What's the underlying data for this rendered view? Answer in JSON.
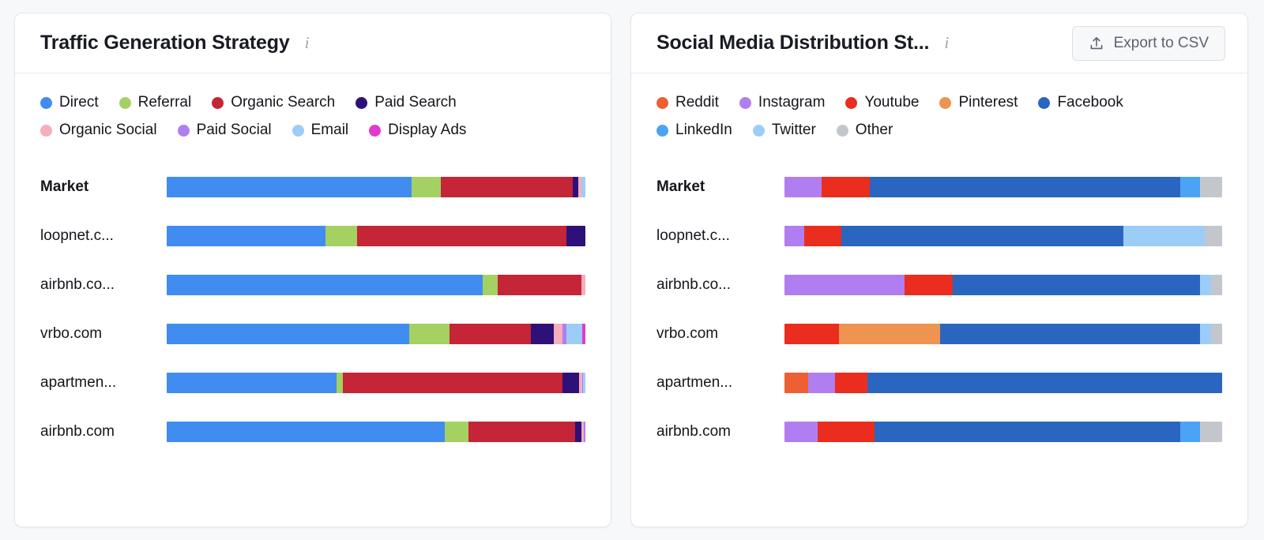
{
  "panels": [
    {
      "title": "Traffic Generation Strategy",
      "info_icon": "info-icon",
      "has_export": false,
      "export_label": "",
      "legend": [
        {
          "label": "Direct",
          "color": "#418cf0"
        },
        {
          "label": "Referral",
          "color": "#a4d162"
        },
        {
          "label": "Organic Search",
          "color": "#c42537"
        },
        {
          "label": "Paid Search",
          "color": "#2e1178"
        },
        {
          "label": "Organic Social",
          "color": "#f4aebc"
        },
        {
          "label": "Paid Social",
          "color": "#b07ef0"
        },
        {
          "label": "Email",
          "color": "#9ccdf7"
        },
        {
          "label": "Display Ads",
          "color": "#e03ad0"
        }
      ],
      "rows": [
        {
          "label": "Market",
          "bold": true
        },
        {
          "label": "loopnet.c...",
          "bold": false
        },
        {
          "label": "airbnb.co...",
          "bold": false
        },
        {
          "label": "vrbo.com",
          "bold": false
        },
        {
          "label": "apartmen...",
          "bold": false
        },
        {
          "label": "airbnb.com",
          "bold": false
        }
      ],
      "chart_data": {
        "type": "bar",
        "title": "Traffic Generation Strategy",
        "orientation": "horizontal",
        "stacked": true,
        "normalized": true,
        "xlabel": "",
        "ylabel": "Market",
        "xlim": [
          0,
          100
        ],
        "grid": false,
        "legend_position": "top",
        "categories": [
          "Market",
          "loopnet.c...",
          "airbnb.co...",
          "vrbo.com",
          "apartmen...",
          "airbnb.com"
        ],
        "series": [
          {
            "name": "Direct",
            "color": "#418cf0",
            "values": [
              58.5,
              38.0,
              75.5,
              58.0,
              40.5,
              66.5
            ]
          },
          {
            "name": "Referral",
            "color": "#a4d162",
            "values": [
              7.0,
              7.5,
              3.5,
              9.5,
              1.5,
              5.5
            ]
          },
          {
            "name": "Organic Search",
            "color": "#c42537",
            "values": [
              31.5,
              50.0,
              20.0,
              19.5,
              52.5,
              25.5
            ]
          },
          {
            "name": "Paid Search",
            "color": "#2e1178",
            "values": [
              1.3,
              4.5,
              0.0,
              5.5,
              4.0,
              1.5
            ]
          },
          {
            "name": "Organic Social",
            "color": "#f4aebc",
            "values": [
              0.8,
              0.0,
              1.0,
              2.0,
              0.7,
              0.7
            ]
          },
          {
            "name": "Paid Social",
            "color": "#b07ef0",
            "values": [
              0.0,
              0.0,
              0.0,
              1.0,
              0.3,
              0.3
            ]
          },
          {
            "name": "Email",
            "color": "#9ccdf7",
            "values": [
              0.9,
              0.0,
              0.0,
              3.8,
              0.5,
              0.0
            ]
          },
          {
            "name": "Display Ads",
            "color": "#e03ad0",
            "values": [
              0.0,
              0.0,
              0.0,
              0.7,
              0.0,
              0.0
            ]
          }
        ]
      }
    },
    {
      "title": "Social Media Distribution St...",
      "info_icon": "info-icon",
      "has_export": true,
      "export_label": "Export to CSV",
      "legend": [
        {
          "label": "Reddit",
          "color": "#ec6033"
        },
        {
          "label": "Instagram",
          "color": "#b07ef0"
        },
        {
          "label": "Youtube",
          "color": "#ea2d1e"
        },
        {
          "label": "Pinterest",
          "color": "#ef9350"
        },
        {
          "label": "Facebook",
          "color": "#2a66c0"
        },
        {
          "label": "LinkedIn",
          "color": "#4ba3f5"
        },
        {
          "label": "Twitter",
          "color": "#9ccdf7"
        },
        {
          "label": "Other",
          "color": "#c3c7cd"
        }
      ],
      "rows": [
        {
          "label": "Market",
          "bold": true
        },
        {
          "label": "loopnet.c...",
          "bold": false
        },
        {
          "label": "airbnb.co...",
          "bold": false
        },
        {
          "label": "vrbo.com",
          "bold": false
        },
        {
          "label": "apartmen...",
          "bold": false
        },
        {
          "label": "airbnb.com",
          "bold": false
        }
      ],
      "chart_data": {
        "type": "bar",
        "title": "Social Media Distribution Strategy",
        "orientation": "horizontal",
        "stacked": true,
        "normalized": true,
        "xlabel": "",
        "ylabel": "Market",
        "xlim": [
          0,
          100
        ],
        "grid": false,
        "legend_position": "top",
        "categories": [
          "Market",
          "loopnet.c...",
          "airbnb.co...",
          "vrbo.com",
          "apartmen...",
          "airbnb.com"
        ],
        "series": [
          {
            "name": "Reddit",
            "color": "#ec6033",
            "values": [
              0.0,
              0.0,
              0.0,
              0.0,
              5.5,
              0.0
            ]
          },
          {
            "name": "Instagram",
            "color": "#b07ef0",
            "values": [
              8.5,
              4.5,
              27.5,
              0.0,
              6.0,
              7.5
            ]
          },
          {
            "name": "Youtube",
            "color": "#ea2d1e",
            "values": [
              11.0,
              8.5,
              11.0,
              12.5,
              7.5,
              13.0
            ]
          },
          {
            "name": "Pinterest",
            "color": "#ef9350",
            "values": [
              0.0,
              0.0,
              0.0,
              23.0,
              0.0,
              0.0
            ]
          },
          {
            "name": "Facebook",
            "color": "#2a66c0",
            "values": [
              71.0,
              64.5,
              56.5,
              59.5,
              81.0,
              70.0
            ]
          },
          {
            "name": "LinkedIn",
            "color": "#4ba3f5",
            "values": [
              4.5,
              0.0,
              0.0,
              0.0,
              0.0,
              4.5
            ]
          },
          {
            "name": "Twitter",
            "color": "#9ccdf7",
            "values": [
              0.0,
              18.5,
              2.5,
              2.5,
              0.0,
              0.0
            ]
          },
          {
            "name": "Other",
            "color": "#c3c7cd",
            "values": [
              5.0,
              4.0,
              2.5,
              2.5,
              0.0,
              5.0
            ]
          }
        ]
      }
    }
  ]
}
